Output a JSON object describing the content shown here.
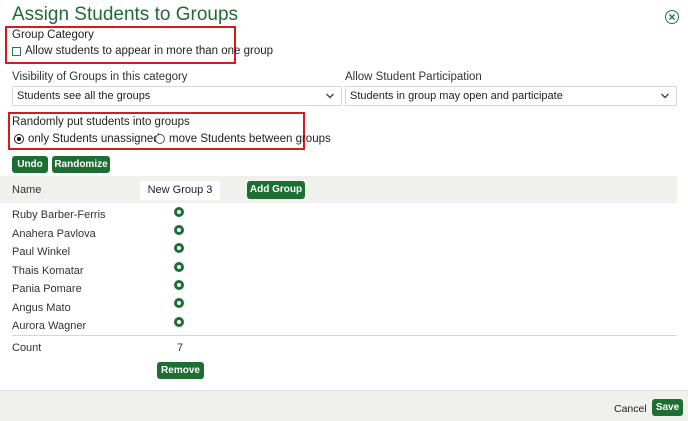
{
  "dialog": {
    "title": "Assign Students to Groups",
    "close_icon": "close-circle-icon"
  },
  "group_category": {
    "label": "Group Category",
    "allow_multiple_label": "Allow students to appear in more than one group",
    "allow_multiple_checked": false
  },
  "visibility": {
    "label": "Visibility of Groups in this category",
    "value": "Students see all the groups"
  },
  "participation": {
    "label": "Allow Student Participation",
    "value": "Students in group may open and participate"
  },
  "randomize": {
    "label": "Randomly put students into groups",
    "options": [
      {
        "label": "only Students unassigned",
        "checked": true
      },
      {
        "label": "move Students between groups",
        "checked": false
      }
    ]
  },
  "toolbar": {
    "undo_label": "Undo",
    "randomize_label": "Randomize"
  },
  "table": {
    "name_header": "Name",
    "group_name": "New Group 3",
    "add_group_label": "Add Group",
    "students": [
      {
        "name": "Ruby Barber-Ferris",
        "assigned": true
      },
      {
        "name": "Anahera Pavlova",
        "assigned": true
      },
      {
        "name": "Paul Winkel",
        "assigned": true
      },
      {
        "name": "Thais Komatar",
        "assigned": true
      },
      {
        "name": "Pania Pomare",
        "assigned": true
      },
      {
        "name": "Angus Mato",
        "assigned": true
      },
      {
        "name": "Aurora Wagner",
        "assigned": true
      }
    ],
    "count_label": "Count",
    "count_value": "7",
    "remove_label": "Remove"
  },
  "footer": {
    "cancel_label": "Cancel",
    "save_label": "Save"
  },
  "colors": {
    "accent": "#1c6e32",
    "highlight": "#d71920"
  }
}
